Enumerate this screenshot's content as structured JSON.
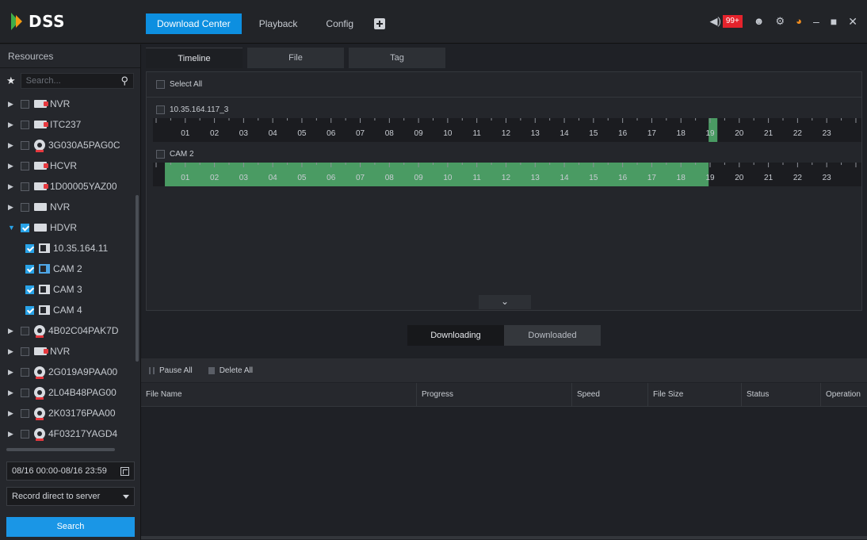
{
  "app": {
    "logo_text": "DSS",
    "nav_tabs": [
      {
        "label": "Download Center",
        "active": true
      },
      {
        "label": "Playback",
        "active": false
      },
      {
        "label": "Config",
        "active": false
      }
    ],
    "alarm_badge": "99+",
    "accent_color": "#0d8fe0"
  },
  "left_panel": {
    "title": "Resources",
    "search_placeholder": "Search...",
    "tree": [
      {
        "label": "NVR",
        "icon": "nvr-icon",
        "checked": false,
        "expanded": false
      },
      {
        "label": "ITC237",
        "icon": "nvr-icon",
        "checked": false,
        "expanded": false
      },
      {
        "label": "3G030A5PAG0C",
        "icon": "camera-device-icon",
        "checked": false,
        "expanded": false
      },
      {
        "label": "HCVR",
        "icon": "nvr-icon",
        "checked": false,
        "expanded": false
      },
      {
        "label": "1D00005YAZ00",
        "icon": "nvr-icon",
        "checked": false,
        "expanded": false
      },
      {
        "label": "NVR",
        "icon": "nvr-icon",
        "checked": false,
        "expanded": false
      },
      {
        "label": "HDVR",
        "icon": "nvr-icon",
        "checked": true,
        "expanded": true
      },
      {
        "label": "10.35.164.11",
        "icon": "channel-icon",
        "checked": true,
        "child": true
      },
      {
        "label": "CAM 2",
        "icon": "channel-icon",
        "checked": true,
        "child": true
      },
      {
        "label": "CAM 3",
        "icon": "channel-icon",
        "checked": true,
        "child": true
      },
      {
        "label": "CAM 4",
        "icon": "channel-icon",
        "checked": true,
        "child": true
      },
      {
        "label": "4B02C04PAK7D",
        "icon": "camera-device-icon",
        "checked": false,
        "expanded": false
      },
      {
        "label": "NVR",
        "icon": "nvr-icon",
        "checked": false,
        "expanded": false
      },
      {
        "label": "2G019A9PAA00",
        "icon": "camera-device-icon",
        "checked": false,
        "expanded": false
      },
      {
        "label": "2L04B48PAG00",
        "icon": "camera-device-icon",
        "checked": false,
        "expanded": false
      },
      {
        "label": "2K03176PAA00",
        "icon": "camera-device-icon",
        "checked": false,
        "expanded": false
      },
      {
        "label": "4F03217YAGD4",
        "icon": "camera-device-icon",
        "checked": false,
        "expanded": false
      }
    ],
    "time_range": "08/16 00:00-08/16 23:59",
    "record_mode": "Record direct to server",
    "search_button": "Search"
  },
  "main": {
    "sub_tabs": [
      {
        "label": "Timeline",
        "active": true
      },
      {
        "label": "File",
        "active": false
      },
      {
        "label": "Tag",
        "active": false
      }
    ],
    "select_all": "Select All",
    "hours": [
      "01",
      "02",
      "03",
      "04",
      "05",
      "06",
      "07",
      "08",
      "09",
      "10",
      "11",
      "12",
      "13",
      "14",
      "15",
      "16",
      "17",
      "18",
      "19",
      "20",
      "21",
      "22",
      "23"
    ],
    "channels": [
      {
        "name": "10.35.164.117_3",
        "record_hours": [
          [
            18.95,
            19.25
          ]
        ]
      },
      {
        "name": "CAM 2",
        "record_hours": [
          [
            0.3,
            18.95
          ]
        ]
      }
    ],
    "record_color": "#4a9b63",
    "download_tabs": [
      {
        "label": "Downloading",
        "active": true
      },
      {
        "label": "Downloaded",
        "active": false
      }
    ],
    "toolbar": {
      "pause_all": "Pause All",
      "delete_all": "Delete All"
    },
    "columns": [
      "File Name",
      "Progress",
      "Speed",
      "File Size",
      "Status",
      "Operation"
    ]
  }
}
